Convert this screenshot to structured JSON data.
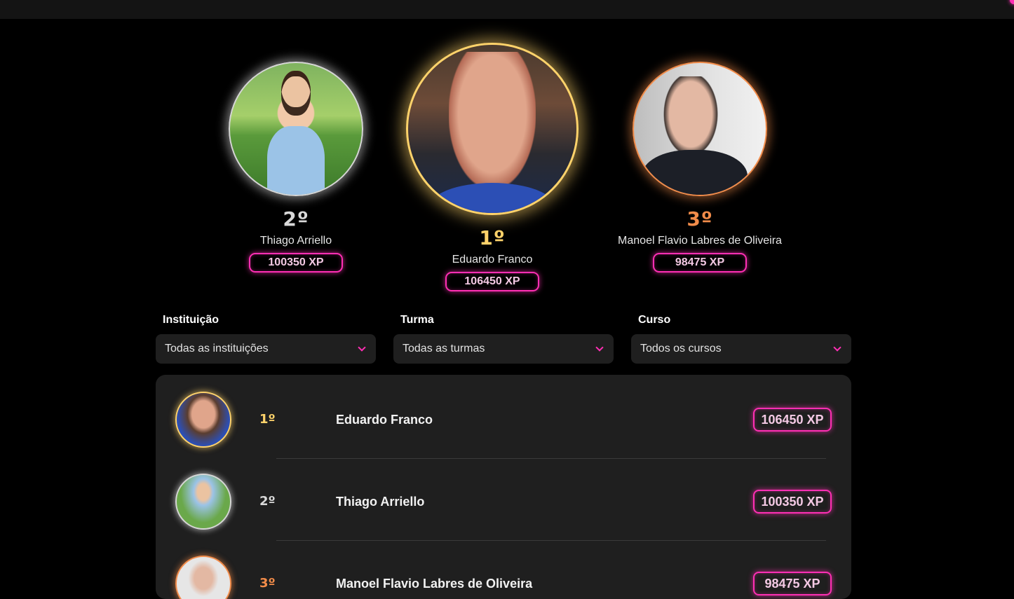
{
  "podium": [
    {
      "position": "1º",
      "name": "Eduardo Franco",
      "xp": "106450 XP"
    },
    {
      "position": "2º",
      "name": "Thiago Arriello",
      "xp": "100350 XP"
    },
    {
      "position": "3º",
      "name": "Manoel Flavio Labres de Oliveira",
      "xp": "98475 XP"
    }
  ],
  "filters": [
    {
      "label": "Instituição",
      "value": "Todas as instituições"
    },
    {
      "label": "Turma",
      "value": "Todas as turmas"
    },
    {
      "label": "Curso",
      "value": "Todos os cursos"
    }
  ],
  "ranking": [
    {
      "position": "1º",
      "name": "Eduardo Franco",
      "xp": "106450 XP"
    },
    {
      "position": "2º",
      "name": "Thiago Arriello",
      "xp": "100350 XP"
    },
    {
      "position": "3º",
      "name": "Manoel Flavio Labres de Oliveira",
      "xp": "98475 XP"
    }
  ],
  "colors": {
    "accent": "#ff2fb4",
    "gold": "#ffd36b",
    "silver": "#d9d9d9",
    "bronze": "#f28c4a",
    "background": "#000000",
    "panel": "#1f1f1f"
  }
}
